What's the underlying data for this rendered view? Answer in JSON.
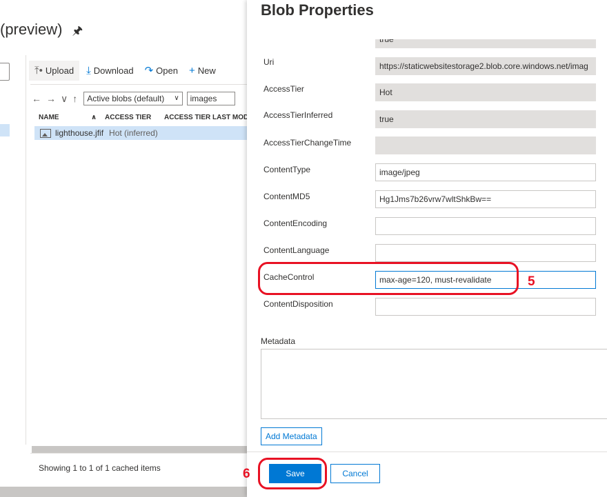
{
  "explorer": {
    "title": "(preview)",
    "toolbar": {
      "upload": "Upload",
      "download": "Download",
      "open": "Open",
      "new": "New"
    },
    "nav": {
      "filter": "Active blobs (default)",
      "path": "images"
    },
    "columns": [
      "NAME",
      "ACCESS TIER",
      "ACCESS TIER LAST MOD"
    ],
    "rows": [
      {
        "name": "lighthouse.jfif",
        "tier": "Hot (inferred)"
      }
    ],
    "status": "Showing 1 to 1 of 1 cached items"
  },
  "dialog": {
    "title": "Blob Properties",
    "properties": [
      {
        "label": "",
        "value": "true",
        "readonly": true
      },
      {
        "label": "Uri",
        "value": "https://staticwebsitestorage2.blob.core.windows.net/imag",
        "readonly": true
      },
      {
        "label": "AccessTier",
        "value": "Hot",
        "readonly": true
      },
      {
        "label": "AccessTierInferred",
        "value": "true",
        "readonly": true
      },
      {
        "label": "AccessTierChangeTime",
        "value": "",
        "readonly": true
      },
      {
        "label": "ContentType",
        "value": "image/jpeg",
        "readonly": false
      },
      {
        "label": "ContentMD5",
        "value": "Hg1Jms7b26vrw7wltShkBw==",
        "readonly": false
      },
      {
        "label": "ContentEncoding",
        "value": "",
        "readonly": false
      },
      {
        "label": "ContentLanguage",
        "value": "",
        "readonly": false
      },
      {
        "label": "CacheControl",
        "value": "max-age=120, must-revalidate",
        "readonly": false
      },
      {
        "label": "ContentDisposition",
        "value": "",
        "readonly": false
      }
    ],
    "metadata_label": "Metadata",
    "add_metadata": "Add Metadata",
    "save": "Save",
    "cancel": "Cancel"
  },
  "annotations": {
    "step5": "5",
    "step6": "6"
  },
  "colors": {
    "accent": "#0078d4",
    "annotation": "#e81123",
    "selection": "#cfe3f7"
  }
}
